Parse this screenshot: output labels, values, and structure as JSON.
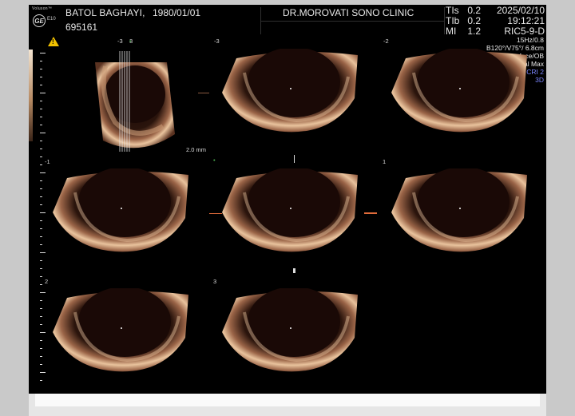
{
  "header": {
    "brand": "Voluson™",
    "model": "E10",
    "logo": "GE",
    "patient_name": "BATOL BAGHAYI,",
    "patient_dob": "1980/01/01",
    "patient_id": "695161",
    "clinic": "DR.MOROVATI SONO CLINIC",
    "indices": [
      {
        "label": "TIs",
        "value": "0.2"
      },
      {
        "label": "TIb",
        "value": "0.2"
      },
      {
        "label": "MI",
        "value": "1.2"
      }
    ],
    "date": "2025/02/10",
    "time": "19:12:21",
    "probe": "RIC5-9-D"
  },
  "params": {
    "frame_rate": "15Hz/0.8",
    "beam": "B120°/V75°/ 6.8cm",
    "render_mode": "Surface/OB",
    "quality": "Qual Max",
    "cri": "CRI 2",
    "mode_3d": "3D"
  },
  "warning_icon": "warning-triangle-icon",
  "slice_spacing": "2.0 mm",
  "slice_labels": {
    "ref": "-3",
    "slice_1": "-3",
    "slice_2": "-2",
    "slice_3": "-1",
    "slice_4": "1",
    "slice_5": "2",
    "slice_6": "3"
  },
  "colors": {
    "tissue_bright": "#e9c39d",
    "tissue_mid": "#9a6447",
    "tissue_dark": "#2a140c",
    "cavity": "#1a0906",
    "warning": "#f2c200",
    "cri_blue": "#7c86ff"
  }
}
